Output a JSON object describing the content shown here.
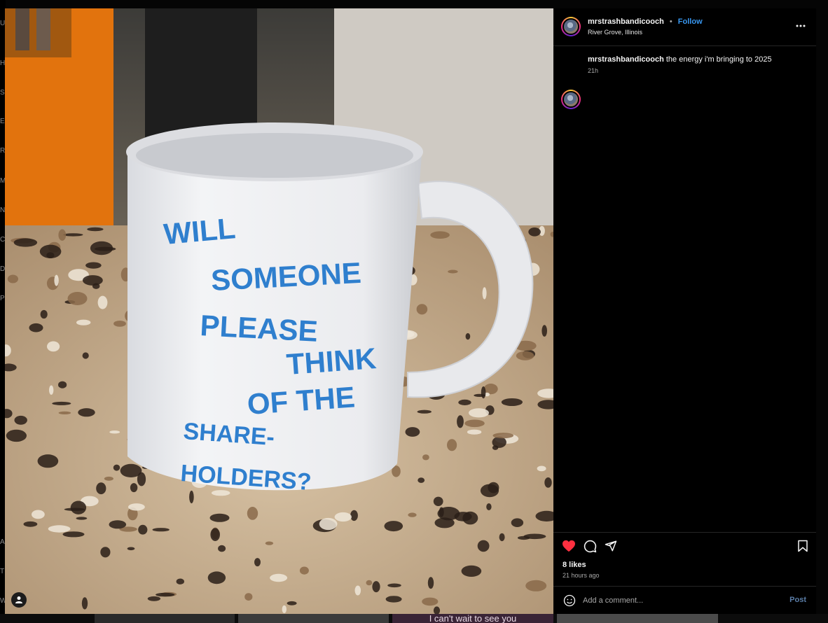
{
  "post": {
    "username": "mrstrashbandicooch",
    "separator": "•",
    "follow_label": "Follow",
    "location": "River Grove, Illinois",
    "caption": "the energy i'm bringing to 2025",
    "caption_time": "21h",
    "likes": "8 likes",
    "posted_ago": "21 hours ago",
    "liked": true
  },
  "mug": {
    "lines": [
      "WILL",
      "SOMEONE",
      "PLEASE",
      "THINK",
      "OF THE",
      "SHARE-",
      "HOLDERS?"
    ],
    "text_color": "#2f7fce"
  },
  "comment": {
    "placeholder": "Add a comment...",
    "post_label": "Post"
  },
  "background_page": {
    "caption_snippet": "I can't wait to see you",
    "left_letters": [
      "U",
      "H",
      "S",
      "E",
      "R",
      "M",
      "N",
      "C",
      "D",
      "P",
      "A",
      "T",
      "W"
    ]
  },
  "colors": {
    "accent": "#3897f0",
    "like": "#ff3040",
    "post_disabled": "#5b7ea8"
  }
}
